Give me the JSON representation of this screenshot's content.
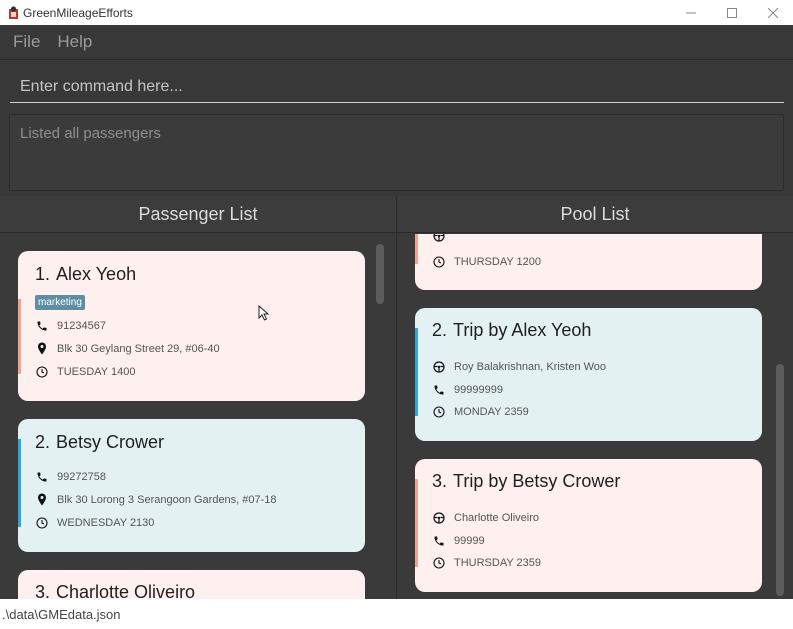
{
  "window": {
    "title": "GreenMileageEfforts",
    "controls": {
      "minimize": "—",
      "maximize": "☐",
      "close": "✕"
    }
  },
  "menu": {
    "items": [
      "File",
      "Help"
    ]
  },
  "command": {
    "placeholder": "Enter command here..."
  },
  "result": {
    "text": "Listed all passengers"
  },
  "passenger_list": {
    "header": "Passenger List",
    "items": [
      {
        "index": "1.",
        "name": "Alex Yeoh",
        "tag": "marketing",
        "phone": "91234567",
        "address": "Blk 30 Geylang Street 29, #06-40",
        "time": "TUESDAY 1400",
        "color": "pink"
      },
      {
        "index": "2.",
        "name": "Betsy Crower",
        "tag": "",
        "phone": "99272758",
        "address": "Blk 30 Lorong 3 Serangoon Gardens, #07-18",
        "time": "WEDNESDAY 2130",
        "color": "blue"
      },
      {
        "index": "3.",
        "name": "Charlotte Oliveiro",
        "color": "pink"
      }
    ]
  },
  "pool_list": {
    "header": "Pool List",
    "items": [
      {
        "time": "THURSDAY 1200",
        "color": "pink"
      },
      {
        "index": "2.",
        "title": "Trip by Alex Yeoh",
        "passengers": "Roy Balakrishnan, Kristen Woo",
        "phone": "99999999",
        "time": "MONDAY 2359",
        "color": "blue"
      },
      {
        "index": "3.",
        "title": "Trip by Betsy Crower",
        "passengers": "Charlotte Oliveiro",
        "phone": "99999",
        "time": "THURSDAY 2359",
        "color": "pink"
      }
    ]
  },
  "status": {
    "path": ".\\data\\GMEdata.json"
  },
  "icons": {
    "phone": "phone-icon",
    "address": "map-pin-icon",
    "time": "clock-icon",
    "driver": "steering-wheel-icon"
  },
  "colors": {
    "pink_card": "#fdf0ee",
    "blue_card": "#e3f1f2",
    "pink_stripe": "#f0a48e",
    "blue_stripe": "#2ea6d6",
    "tag": "#5e8ea4",
    "background": "#3a3a3a"
  }
}
